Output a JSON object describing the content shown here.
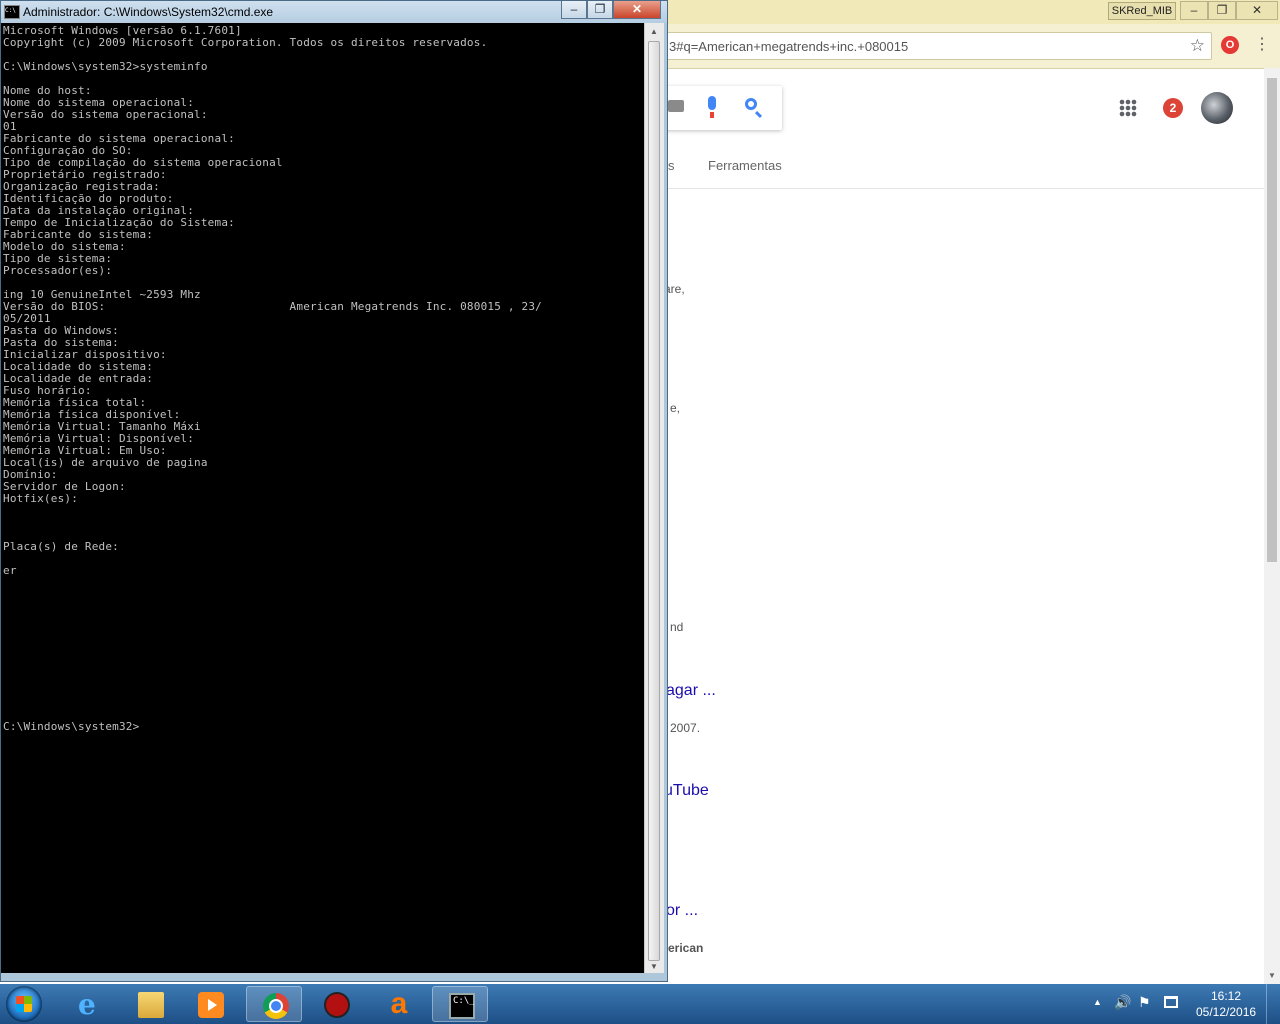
{
  "browser": {
    "profile_name": "SKRed_MIB",
    "window_buttons": {
      "minimize": "‒",
      "restore": "❐",
      "close": "✕"
    },
    "url_fragment": "3#q=American+megatrends+inc.+080015",
    "notification_count": "2",
    "tabs_fragment": "s",
    "tools_tab_label": "Ferramentas",
    "result_fragments": [
      {
        "text": "are,",
        "kind": "snip"
      },
      {
        "text": "e,",
        "kind": "snip"
      },
      {
        "text": "nd",
        "kind": "snip"
      },
      {
        "text": "agar ...",
        "kind": "link"
      },
      {
        "text": "2007.",
        "kind": "snip"
      },
      {
        "text": "uTube",
        "kind": "link"
      },
      {
        "text": "or ...",
        "kind": "link"
      },
      {
        "text": "erican",
        "kind": "bold"
      }
    ],
    "icons": {
      "star": "star-icon",
      "extension": "opera-icon",
      "menu": "menu-icon",
      "keyboard": "keyboard-icon",
      "mic": "mic-icon",
      "search": "search-icon",
      "apps": "apps-grid-icon",
      "avatar": "avatar"
    }
  },
  "cmd": {
    "title": "Administrador: C:\\Windows\\System32\\cmd.exe",
    "window_buttons": {
      "minimize": "‒",
      "restore": "❐",
      "close": "✕"
    },
    "lines": [
      "Microsoft Windows [versão 6.1.7601]",
      "Copyright (c) 2009 Microsoft Corporation. Todos os direitos reservados.",
      "",
      "C:\\Windows\\system32>systeminfo",
      "",
      "Nome do host:",
      "Nome do sistema operacional:",
      "Versão do sistema operacional:",
      "01",
      "Fabricante do sistema operacional:",
      "Configuração do SO:",
      "Tipo de compilação do sistema operacional",
      "Proprietário registrado:",
      "Organização registrada:",
      "Identificação do produto:",
      "Data da instalação original:",
      "Tempo de Inicialização do Sistema:",
      "Fabricante do sistema:",
      "Modelo do sistema:",
      "Tipo de sistema:",
      "Processador(es):",
      "",
      "ing 10 GenuineIntel ~2593 Mhz",
      "Versão do BIOS:                           American Megatrends Inc. 080015 , 23/",
      "05/2011",
      "Pasta do Windows:",
      "Pasta do sistema:",
      "Inicializar dispositivo:",
      "Localidade do sistema:",
      "Localidade de entrada:",
      "Fuso horário:",
      "Memória física total:",
      "Memória física disponível:",
      "Memória Virtual: Tamanho Máxi",
      "Memória Virtual: Disponível:",
      "Memória Virtual: Em Uso:",
      "Local(is) de arquivo de pagina",
      "Domínio:",
      "Servidor de Logon:",
      "Hotfix(es):",
      "",
      "",
      "",
      "Placa(s) de Rede:",
      "",
      "er",
      "",
      "",
      "",
      "",
      "",
      "",
      "",
      "",
      "",
      "",
      "",
      "",
      "C:\\Windows\\system32>"
    ]
  },
  "taskbar": {
    "clock_time": "16:12",
    "clock_date": "05/12/2016",
    "tray": {
      "arrow": "▲",
      "volume": "🔊",
      "flag": "⚑"
    },
    "apps": [
      {
        "name": "internet-explorer",
        "icon": "ie-icon",
        "glyph": "e"
      },
      {
        "name": "windows-explorer",
        "icon": "folder-icon",
        "glyph": ""
      },
      {
        "name": "media-player",
        "icon": "media-player-icon",
        "glyph": ""
      },
      {
        "name": "google-chrome",
        "icon": "chrome-icon",
        "glyph": ""
      },
      {
        "name": "hunter",
        "icon": "hunter-icon",
        "glyph": ""
      },
      {
        "name": "avast",
        "icon": "avast-icon",
        "glyph": "a"
      },
      {
        "name": "command-prompt",
        "icon": "cmd-icon",
        "glyph": "C:\\_"
      }
    ]
  }
}
